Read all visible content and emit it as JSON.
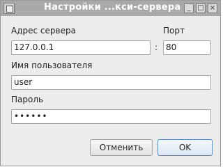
{
  "window": {
    "title": "Настройки ...кси-сервера",
    "controls": {
      "minimize": "_",
      "maximize": "□",
      "close": "×"
    }
  },
  "form": {
    "server_label": "Адрес сервера",
    "port_label": "Порт",
    "server_value": "127.0.0.1",
    "separator": ":",
    "port_value": "80",
    "username_label": "Имя пользователя",
    "username_value": "user",
    "password_label": "Пароль",
    "password_value": "••••••"
  },
  "buttons": {
    "cancel": "Отменить",
    "ok": "OK"
  }
}
